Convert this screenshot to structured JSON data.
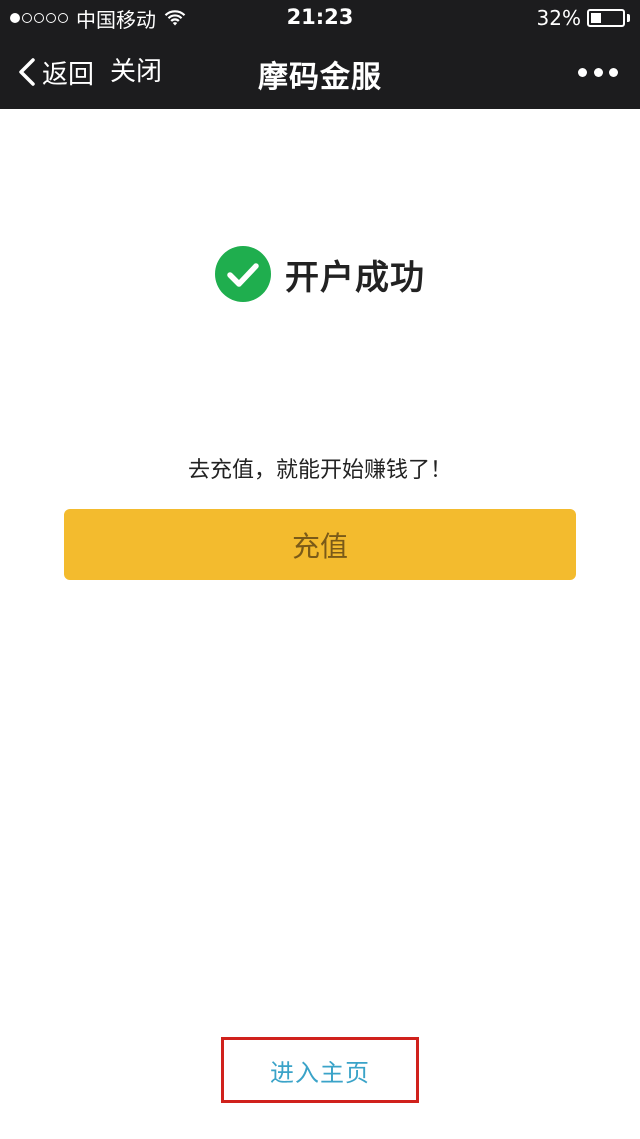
{
  "status_bar": {
    "carrier": "中国移动",
    "time": "21:23",
    "battery": "32%",
    "battery_level": 0.32,
    "signal_bars_filled": 1,
    "signal_bars_total": 5
  },
  "nav": {
    "back_label": "返回",
    "close_label": "关闭",
    "title": "摩码金服"
  },
  "main": {
    "success_title": "开户成功",
    "prompt": "去充值，就能开始赚钱了！",
    "recharge_label": "充值",
    "home_link": "进入主页"
  },
  "colors": {
    "nav_bg": "#1c1c1e",
    "accent_button": "#f3bb2e",
    "success_green": "#1fae4e",
    "link": "#3aa3c8",
    "highlight_border": "#d0211c"
  },
  "icons": {
    "wifi": "wifi-icon",
    "battery": "battery-icon",
    "back": "chevron-left-icon",
    "more": "more-icon",
    "success": "check-circle-icon"
  }
}
